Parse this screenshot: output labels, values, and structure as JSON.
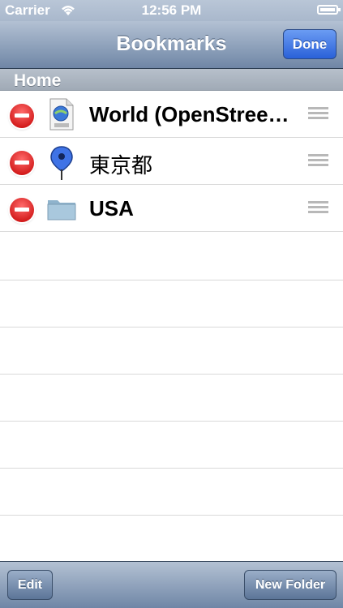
{
  "status_bar": {
    "carrier": "Carrier",
    "time": "12:56 PM"
  },
  "navbar": {
    "title": "Bookmarks",
    "done_label": "Done"
  },
  "section": {
    "label": "Home"
  },
  "bookmarks": [
    {
      "name": "World (OpenStreetMap)",
      "icon": "kml-file-icon"
    },
    {
      "name": "東京都",
      "icon": "map-pin-icon"
    },
    {
      "name": "USA",
      "icon": "folder-icon"
    }
  ],
  "toolbar": {
    "edit_label": "Edit",
    "new_folder_label": "New Folder"
  },
  "colors": {
    "accent": "#2a61d8",
    "delete": "#c40000"
  }
}
